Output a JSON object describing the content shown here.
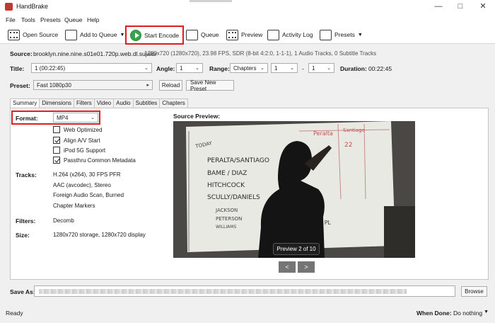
{
  "window": {
    "title": "HandBrake"
  },
  "menu": [
    "File",
    "Tools",
    "Presets",
    "Queue",
    "Help"
  ],
  "toolbar": {
    "open_source": "Open Source",
    "add_to_queue": "Add to Queue",
    "start_encode": "Start Encode",
    "queue": "Queue",
    "preview": "Preview",
    "activity_log": "Activity Log",
    "presets": "Presets"
  },
  "source": {
    "label": "Source:",
    "name": "brooklyn.nine.nine.s01e01.720p.web.dl.sujaidr",
    "info": "1280x720 (1280x720), 23.98 FPS, SDR (8-bit 4:2:0, 1-1-1), 1 Audio Tracks, 0 Subtitle Tracks"
  },
  "title_row": {
    "title_label": "Title:",
    "title_value": "1 (00:22:45)",
    "angle_label": "Angle:",
    "angle_value": "1",
    "range_label": "Range:",
    "range_type": "Chapters",
    "range_from": "1",
    "range_sep": "-",
    "range_to": "1",
    "duration_label": "Duration:",
    "duration_value": "00:22:45"
  },
  "preset_row": {
    "label": "Preset:",
    "value": "Fast 1080p30",
    "reload": "Reload",
    "save_new": "Save New Preset"
  },
  "tabs": [
    "Summary",
    "Dimensions",
    "Filters",
    "Video",
    "Audio",
    "Subtitles",
    "Chapters"
  ],
  "summary": {
    "format_label": "Format:",
    "format_value": "MP4",
    "options": [
      {
        "label": "Web Optimized",
        "checked": false
      },
      {
        "label": "Align A/V Start",
        "checked": true
      },
      {
        "label": "iPod 5G Support",
        "checked": false
      },
      {
        "label": "Passthru Common Metadata",
        "checked": true
      }
    ],
    "tracks_label": "Tracks:",
    "tracks": [
      "H.264 (x264), 30 FPS PFR",
      "AAC (avcodec), Stereo",
      "Foreign Audio Scan, Burned",
      "Chapter Markers"
    ],
    "filters_label": "Filters:",
    "filters_value": "Decomb",
    "size_label": "Size:",
    "size_value": "1280x720 storage, 1280x720 display"
  },
  "source_preview": {
    "label": "Source Preview:",
    "badge": "Preview 2 of 10",
    "prev": "<",
    "next": ">"
  },
  "whiteboard": {
    "today": "TODAY",
    "names": [
      "PERALTA/SANTIAGO",
      "BAME / DIAZ",
      "HITCHCOCK",
      "SCULLY/DANIELS",
      "JACKSON",
      "PETERSON",
      "WILLIAMS"
    ],
    "col1": "Peralta",
    "col2": "Santiago",
    "score": "22",
    "extra": "D PL"
  },
  "save": {
    "label": "Save As:",
    "browse": "Browse"
  },
  "status": {
    "text": "Ready",
    "when_done_label": "When Done:",
    "when_done_value": "Do nothing"
  }
}
